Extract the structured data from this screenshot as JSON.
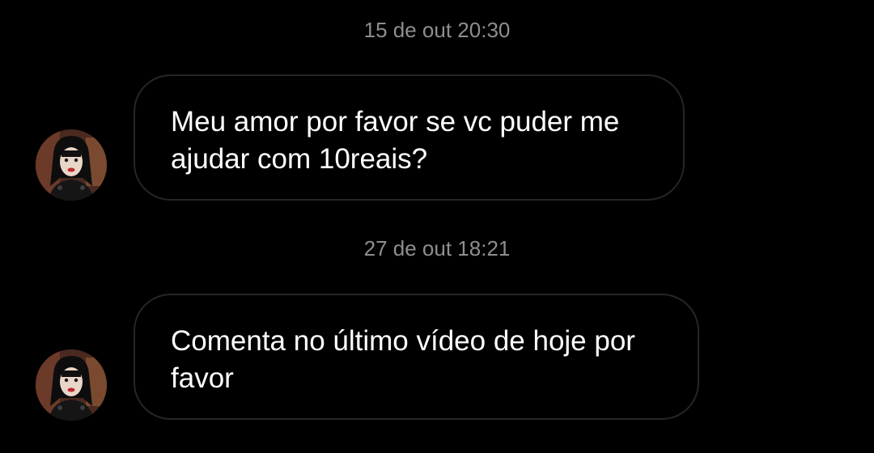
{
  "conversation": {
    "messages": [
      {
        "timestamp": "15 de out 20:30",
        "text": "Meu amor por favor se vc puder me ajudar com 10reais?",
        "sender_avatar_icon": "profile-photo-avatar"
      },
      {
        "timestamp": "27 de out 18:21",
        "text": "Comenta no último vídeo de hoje por favor",
        "sender_avatar_icon": "profile-photo-avatar"
      }
    ]
  },
  "colors": {
    "background": "#000000",
    "bubble_border": "#262626",
    "timestamp_text": "#8e8e8e",
    "message_text": "#ffffff"
  }
}
